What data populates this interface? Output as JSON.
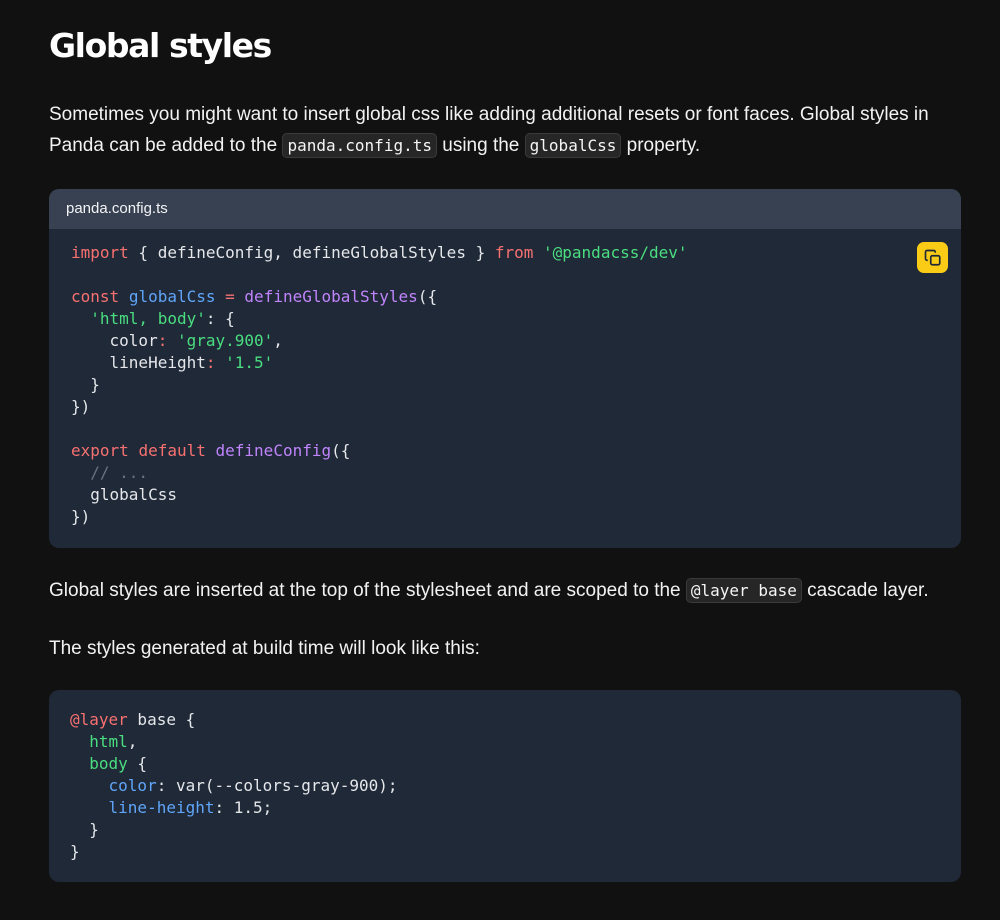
{
  "heading": "Global styles",
  "intro": {
    "part1": "Sometimes you might want to insert global css like adding additional resets or font faces. Global styles in Panda can be added to the ",
    "code1": "panda.config.ts",
    "part2": " using the ",
    "code2": "globalCss",
    "part3": " property."
  },
  "config_block": {
    "filename": "panda.config.ts",
    "copy_icon": "copy-icon",
    "lines": {
      "l1_import": "import",
      "l1_mid": " { defineConfig, defineGlobalStyles } ",
      "l1_from": "from",
      "l1_sp": " ",
      "l1_mod": "'@pandacss/dev'",
      "l3_const": "const",
      "l3_sp": " ",
      "l3_var": "globalCss",
      "l3_eq": " = ",
      "l3_fn": "defineGlobalStyles",
      "l3_paren": "({",
      "l4_indent": "  ",
      "l4_sel": "'html, body'",
      "l4_rest": ": {",
      "l5_key": "    color",
      "l5_colon": ": ",
      "l5_val": "'gray.900'",
      "l5_comma": ",",
      "l6_key": "    lineHeight",
      "l6_colon": ": ",
      "l6_val": "'1.5'",
      "l7": "  }",
      "l8": "})",
      "l10_export": "export",
      "l10_sp": " ",
      "l10_default": "default",
      "l10_sp2": " ",
      "l10_fn": "defineConfig",
      "l10_paren": "({",
      "l11_comment": "  // ...",
      "l12": "  globalCss",
      "l13": "})"
    }
  },
  "para2": {
    "part1": "Global styles are inserted at the top of the stylesheet and are scoped to the ",
    "code": "@layer base",
    "part2": " cascade layer."
  },
  "para3": "The styles generated at build time will look like this:",
  "output_block": {
    "lines": {
      "l1_at": "@layer",
      "l1_rest": " base {",
      "l2": "  html",
      "l2_comma": ",",
      "l3": "  body",
      "l3_rest": " {",
      "l4_prop": "    color",
      "l4_colon": ": ",
      "l4_val": "var(--colors-gray-900);",
      "l5_prop": "    line-height",
      "l5_colon": ": ",
      "l5_val": "1.5;",
      "l6": "  }",
      "l7": "}"
    }
  }
}
